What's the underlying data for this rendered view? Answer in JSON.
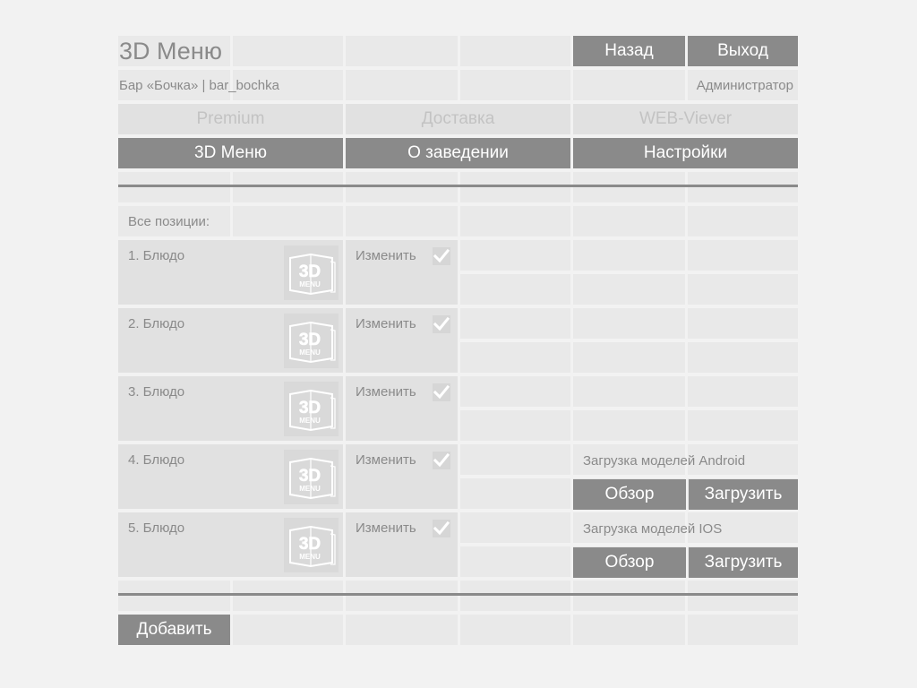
{
  "header": {
    "title": "3D Меню",
    "venue": "Бар «Бочка» | bar_bochka",
    "role": "Администратор",
    "back_label": "Назад",
    "exit_label": "Выход"
  },
  "nav": {
    "disabled": [
      "Premium",
      "Доставка",
      "WEB-Viever"
    ],
    "active": [
      "3D Меню",
      "О заведении",
      "Настройки"
    ]
  },
  "list": {
    "heading": "Все позиции:",
    "edit_label": "Изменить",
    "items": [
      {
        "name": "1. Блюдо",
        "checked": true
      },
      {
        "name": "2. Блюдо",
        "checked": true
      },
      {
        "name": "3. Блюдо",
        "checked": true
      },
      {
        "name": "4. Блюдо",
        "checked": true
      },
      {
        "name": "5. Блюдо",
        "checked": true
      }
    ],
    "logo_text": [
      "3D",
      "MENU"
    ]
  },
  "uploads": {
    "android": {
      "label": "Загрузка моделей Android",
      "browse": "Обзор",
      "upload": "Загрузить"
    },
    "ios": {
      "label": "Загрузка моделей IOS",
      "browse": "Обзор",
      "upload": "Загрузить"
    }
  },
  "footer": {
    "add_label": "Добавить"
  },
  "colors": {
    "background": "#f2f2f2",
    "cell": "#e9e9e9",
    "button": "#8a8a8a",
    "text": "#8a8a8a"
  }
}
